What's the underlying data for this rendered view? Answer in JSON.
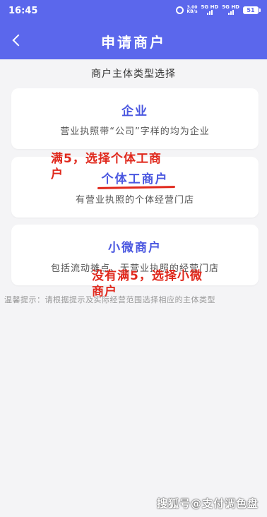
{
  "status": {
    "time": "16:45",
    "net_speed_value": "3.00",
    "net_speed_unit": "KB/s",
    "signal1": "5G HD",
    "signal2": "5G HD",
    "battery": "51"
  },
  "header": {
    "title": "申请商户"
  },
  "section": {
    "title": "商户主体类型选择"
  },
  "cards": [
    {
      "title": "企业",
      "desc": "营业执照带“公司”字样的均为企业"
    },
    {
      "title": "个体工商户",
      "desc": "有营业执照的个体经营门店"
    },
    {
      "title": "小微商户",
      "desc": "包括流动摊点、无营业执照的经营门店"
    }
  ],
  "tip": "温馨提示：请根据提示及实际经营范围选择相应的主体类型",
  "annotations": {
    "a1_line1": "满5，选择个体工商",
    "a1_line2": "户",
    "a2_line1": "没有满5，选择小微",
    "a2_line2": "商户",
    "color": "#e0281c"
  },
  "watermark": "搜狐号@支付调色盘",
  "colors": {
    "accent": "#5b67ec",
    "card_title": "#4a57e0",
    "background": "#f4f4f6"
  }
}
